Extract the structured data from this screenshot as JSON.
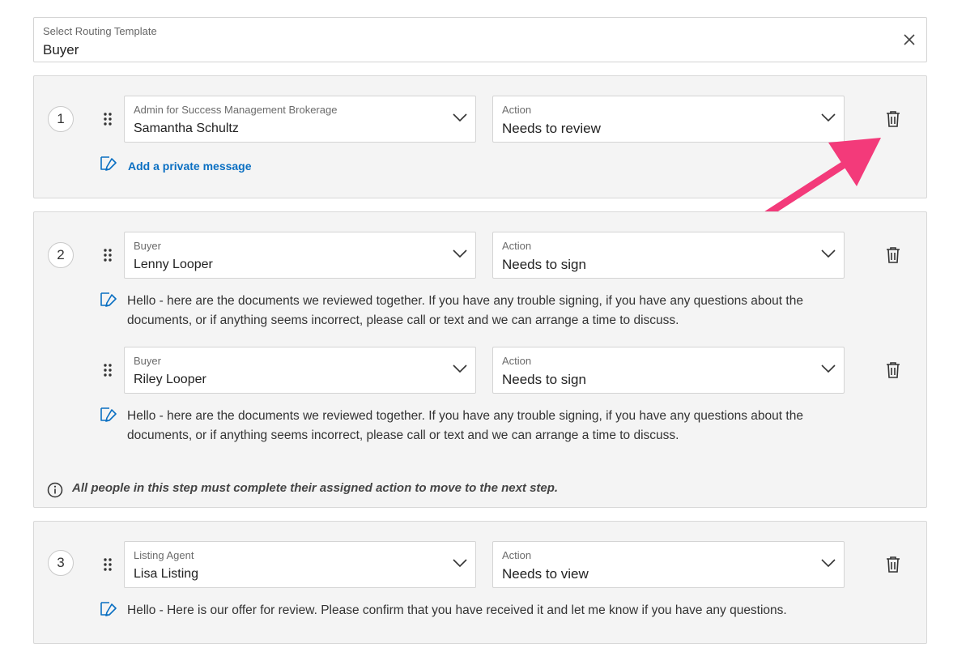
{
  "template": {
    "label": "Select Routing Template",
    "value": "Buyer"
  },
  "steps": [
    {
      "number": "1",
      "recipients": [
        {
          "role": "Admin for Success Management Brokerage",
          "name": "Samantha Schultz",
          "action_label": "Action",
          "action": "Needs to review",
          "add_message": "Add a private message"
        }
      ]
    },
    {
      "number": "2",
      "recipients": [
        {
          "role": "Buyer",
          "name": "Lenny Looper",
          "action_label": "Action",
          "action": "Needs to sign",
          "message_line1": "Hello - here are the documents we reviewed together. If you have any trouble signing, if you have any questions about the",
          "message_line2": "documents, or if anything seems incorrect, please call or text and we can arrange a time to discuss."
        },
        {
          "role": "Buyer",
          "name": "Riley Looper",
          "action_label": "Action",
          "action": "Needs to sign",
          "message_line1": "Hello - here are the documents we reviewed together. If you have any trouble signing, if you have any questions about the",
          "message_line2": "documents, or if anything seems incorrect, please call or text and we can arrange a time to discuss."
        }
      ],
      "info": "All people in this step must complete their assigned action to move to the next step."
    },
    {
      "number": "3",
      "recipients": [
        {
          "role": "Listing Agent",
          "name": "Lisa Listing",
          "action_label": "Action",
          "action": "Needs to view",
          "message": "Hello - Here is our offer for review. Please confirm that you have received it and let me know if you have any questions."
        }
      ]
    }
  ],
  "colors": {
    "link": "#0a6fc2",
    "annotation_arrow": "#f33a7a",
    "panel_bg": "#f4f4f4"
  },
  "icons": {
    "clear": "close-icon",
    "drag": "drag-handle-icon",
    "dropdown": "chevron-down-icon",
    "delete": "trash-icon",
    "message": "edit-message-icon",
    "info": "info-icon"
  }
}
